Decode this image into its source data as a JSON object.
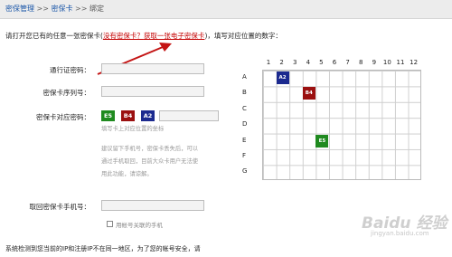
{
  "breadcrumb": {
    "item1": "密保管理",
    "sep1": ">>",
    "item2": "密保卡",
    "sep2": ">>",
    "item3": "绑定"
  },
  "instruction": {
    "pre": "请打开您已有的任意一张密保卡(",
    "link1": "没有密保卡？",
    "link2": "获取一张电子密保卡",
    "post": ")，填写对应位置的数字："
  },
  "form": {
    "login_password_label": "通行证密码：",
    "serial_label": "密保卡序列号：",
    "coord_password_label": "密保卡对应密码：",
    "coords": [
      {
        "text": "E5",
        "color": "#1f8a1f"
      },
      {
        "text": "B4",
        "color": "#9b1010"
      },
      {
        "text": "A2",
        "color": "#1c2a8f"
      }
    ],
    "coord_hint": "填写卡上对应位置的坐标",
    "suggest_hint_1": "建议留下手机号，密保卡丢失后，可以",
    "suggest_hint_2": "通过手机取回，目前大众卡用户无法使",
    "suggest_hint_3": "用此功能，请谅解。",
    "phone_label": "取回密保卡手机号：",
    "checkbox_label": "用帐号关联的手机"
  },
  "bottom_text": "系统检测到您当前的IP和注册IP不在同一地区，为了您的帐号安全，请",
  "card": {
    "columns": [
      "1",
      "2",
      "3",
      "4",
      "5",
      "6",
      "7",
      "8",
      "9",
      "10",
      "11",
      "12"
    ],
    "rows": [
      "A",
      "B",
      "C",
      "D",
      "E",
      "F",
      "G"
    ],
    "marks": [
      {
        "text": "A2",
        "row": 0,
        "col": 1,
        "color": "#1c2a8f"
      },
      {
        "text": "B4",
        "row": 1,
        "col": 3,
        "color": "#9b1010"
      },
      {
        "text": "E5",
        "row": 4,
        "col": 4,
        "color": "#1f8a1f"
      }
    ]
  },
  "watermark": "Baidu 经验",
  "watermark_url": "jingyan.baidu.com"
}
